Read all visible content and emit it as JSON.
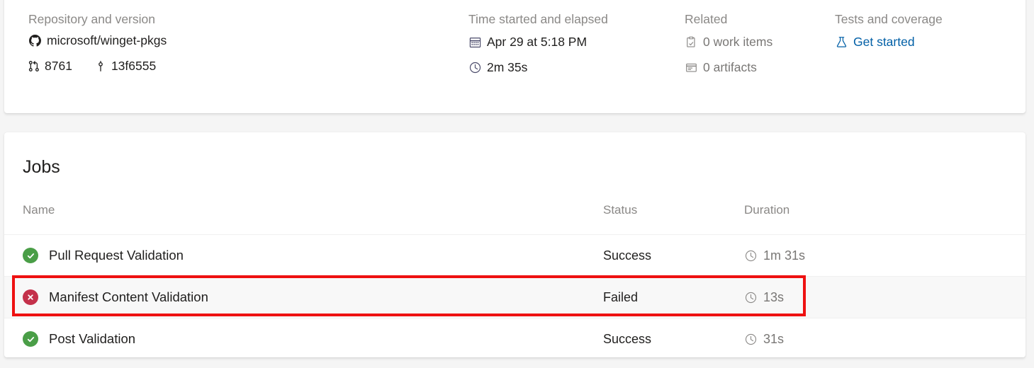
{
  "summary": {
    "repository": {
      "heading": "Repository and version",
      "icon": "github-icon",
      "repo_name": "microsoft/winget-pkgs",
      "pull_request": {
        "icon": "pull-request-icon",
        "value": "8761"
      },
      "commit": {
        "icon": "commit-icon",
        "value": "13f6555"
      }
    },
    "time": {
      "heading": "Time started and elapsed",
      "started": {
        "icon": "calendar-icon",
        "value": "Apr 29 at 5:18 PM"
      },
      "elapsed": {
        "icon": "clock-icon",
        "value": "2m 35s"
      }
    },
    "related": {
      "heading": "Related",
      "work_items": {
        "icon": "work-item-icon",
        "value": "0 work items"
      },
      "artifacts": {
        "icon": "artifact-icon",
        "value": "0 artifacts"
      }
    },
    "tests": {
      "heading": "Tests and coverage",
      "link": {
        "icon": "beaker-icon",
        "label": "Get started"
      }
    }
  },
  "jobs": {
    "title": "Jobs",
    "columns": {
      "name": "Name",
      "status": "Status",
      "duration": "Duration"
    },
    "rows": [
      {
        "name": "Pull Request Validation",
        "status": "Success",
        "status_icon": "success-check-icon",
        "duration": "1m 31s",
        "duration_icon": "clock-icon",
        "highlighted": false
      },
      {
        "name": "Manifest Content Validation",
        "status": "Failed",
        "status_icon": "failed-x-icon",
        "duration": "13s",
        "duration_icon": "clock-icon",
        "highlighted": true
      },
      {
        "name": "Post Validation",
        "status": "Success",
        "status_icon": "success-check-icon",
        "duration": "31s",
        "duration_icon": "clock-icon",
        "highlighted": false
      }
    ]
  },
  "annotation": {
    "shape": "rectangle",
    "color": "#ee1111",
    "target": "Manifest Content Validation"
  },
  "colors": {
    "success": "#4a9e47",
    "failed": "#c4314b",
    "link": "#005fa6",
    "muted": "#8a8886",
    "text": "#201f1e",
    "annotation": "#ee1111",
    "row_highlight": "#f8f8f8"
  }
}
